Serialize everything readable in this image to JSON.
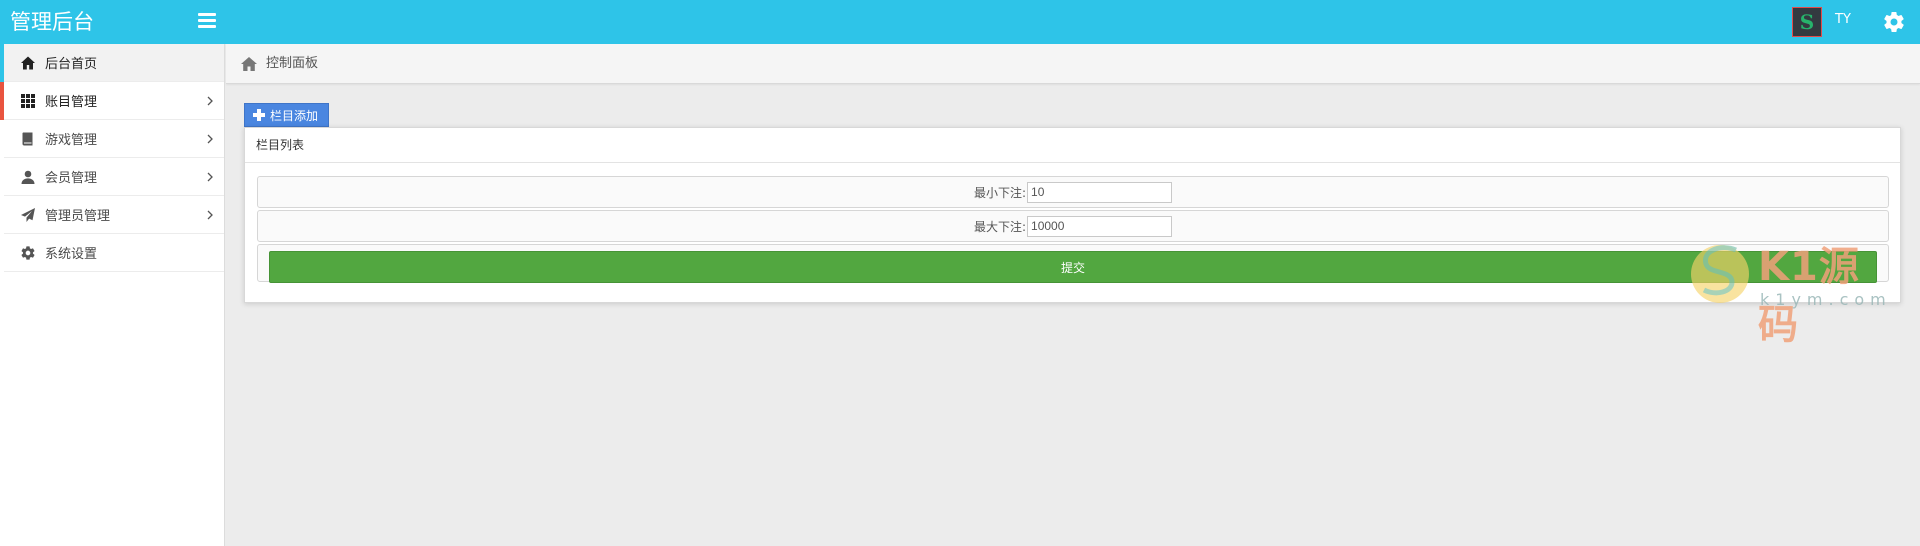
{
  "header": {
    "brand": "管理后台",
    "username": "TY",
    "avatar_letter": "S"
  },
  "sidebar": {
    "items": [
      {
        "label": "后台首页",
        "icon": "home-icon"
      },
      {
        "label": "账目管理",
        "icon": "grid-icon"
      },
      {
        "label": "游戏管理",
        "icon": "book-icon"
      },
      {
        "label": "会员管理",
        "icon": "user-icon"
      },
      {
        "label": "管理员管理",
        "icon": "send-icon"
      },
      {
        "label": "系统设置",
        "icon": "gear-icon"
      }
    ]
  },
  "breadcrumb": {
    "text": "控制面板"
  },
  "toolbar": {
    "add_label": "栏目添加"
  },
  "panel": {
    "title": "栏目列表",
    "fields": [
      {
        "label": "最小下注:",
        "value": "10"
      },
      {
        "label": "最大下注:",
        "value": "10000"
      }
    ],
    "submit_label": "提交"
  },
  "watermark": {
    "brand": "K1源码",
    "url": "k1ym.com"
  },
  "colors": {
    "header": "#2ec4e8",
    "active_bar": "#2ec4e8",
    "current_bar": "#e9543f",
    "add_button": "#4a86e0",
    "submit_button": "#52a740"
  }
}
